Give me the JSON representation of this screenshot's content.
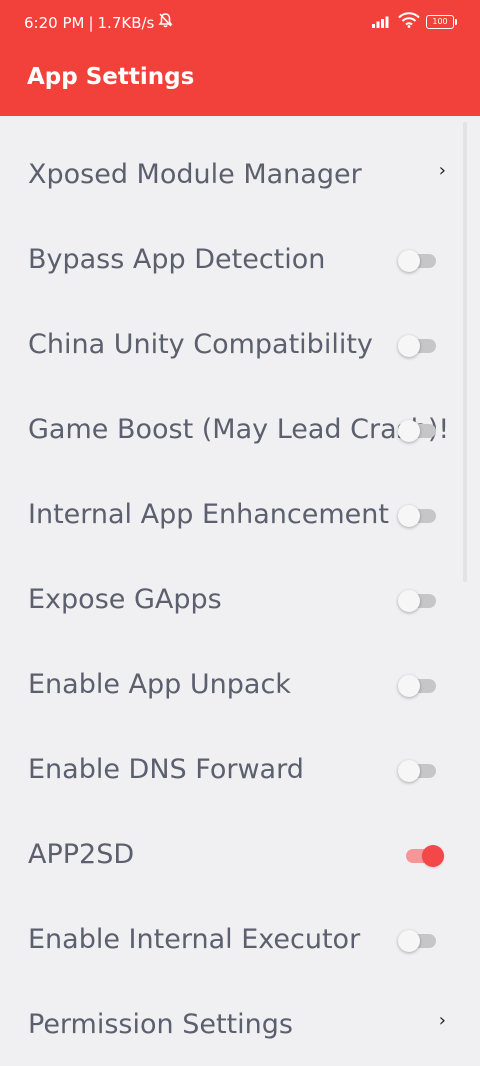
{
  "status_bar": {
    "time": "6:20 PM",
    "separator": "|",
    "network_speed": "1.7KB/s",
    "battery_level": "100",
    "icons": [
      "bell-off-icon",
      "signal-icon",
      "wifi-icon",
      "battery-icon"
    ]
  },
  "app_bar": {
    "title": "App Settings",
    "color": "#f2413a"
  },
  "settings": [
    {
      "label": "Xposed Module Manager",
      "control": "chevron",
      "chevron": "›"
    },
    {
      "label": "Bypass App Detection",
      "control": "toggle",
      "on": false
    },
    {
      "label": "China Unity Compatibility",
      "control": "toggle",
      "on": false
    },
    {
      "label": "Game Boost (May Lead Crash)!",
      "control": "toggle",
      "on": false
    },
    {
      "label": "Internal App Enhancement",
      "control": "toggle",
      "on": false
    },
    {
      "label": "Expose GApps",
      "control": "toggle",
      "on": false
    },
    {
      "label": "Enable App Unpack",
      "control": "toggle",
      "on": false
    },
    {
      "label": "Enable DNS Forward",
      "control": "toggle",
      "on": false
    },
    {
      "label": "APP2SD",
      "control": "toggle",
      "on": true
    },
    {
      "label": "Enable Internal Executor",
      "control": "toggle",
      "on": false
    },
    {
      "label": "Permission Settings",
      "control": "chevron",
      "chevron": "›"
    }
  ],
  "colors": {
    "accent": "#f2413a",
    "toggle_on": "#f4474a",
    "toggle_off_track": "#c6c6c8",
    "label_text": "#5b5f6e",
    "background": "#f0f0f2"
  }
}
